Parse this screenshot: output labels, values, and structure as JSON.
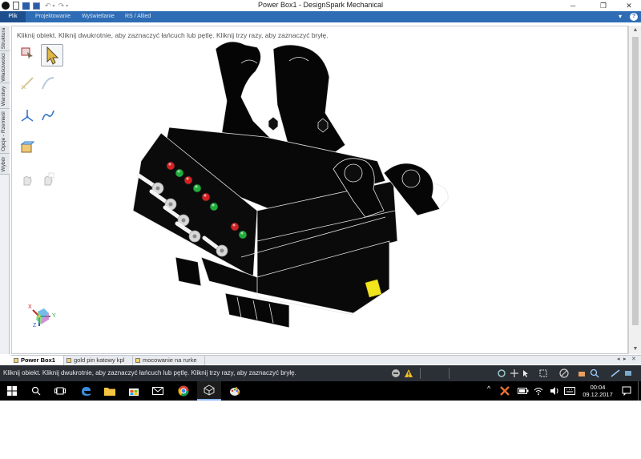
{
  "window": {
    "title": "Power Box1 - DesignSpark Mechanical",
    "minimize_glyph": "─",
    "maximize_glyph": "❐",
    "close_glyph": "✕"
  },
  "ribbon": {
    "tabs": [
      "Plik",
      "Projektowanie",
      "Wyświetlanie",
      "RS / Allied"
    ],
    "active_tab": "Plik"
  },
  "side_tabs": [
    "Struktura",
    "Właściwości",
    "Warstwy",
    "Opcje - Rzemieśl",
    "Wybór"
  ],
  "viewport": {
    "hint": "Kliknij obiekt. Kliknij dwukrotnie, aby zaznaczyć łańcuch lub pętlę. Kliknij trzy razy, aby zaznaczyć bryłę.",
    "axis_labels": {
      "x": "X",
      "y": "Y",
      "z": "Z"
    }
  },
  "tools": [
    {
      "name": "select-box-icon",
      "selected": false
    },
    {
      "name": "select-arrow-icon",
      "selected": true
    },
    {
      "name": "sketch-line-icon",
      "selected": false
    },
    {
      "name": "sketch-curve-icon",
      "selected": false
    },
    {
      "name": "axis-origin-icon",
      "selected": false
    },
    {
      "name": "spline-icon",
      "selected": false
    },
    {
      "name": "component-icon",
      "selected": false
    },
    {
      "name": "hand-tool-icon",
      "selected": false
    },
    {
      "name": "hand-select-icon",
      "selected": false
    }
  ],
  "doc_tabs": [
    {
      "label": "Power Box1",
      "active": true
    },
    {
      "label": "gold pin katowy kpl",
      "active": false
    },
    {
      "label": "mocowanie na rurke",
      "active": false
    }
  ],
  "status": {
    "message": "Kliknij obiekt. Kliknij dwukrotnie, aby zaznaczyć łańcuch lub pętlę. Kliknij trzy razy, aby zaznaczyć bryłę."
  },
  "taskbar": {
    "time": "00:04",
    "date": "09.12.2017"
  },
  "colors": {
    "ribbon": "#2e6db5",
    "ribbon_active": "#1d4f8f",
    "status_bar": "#2b2f36",
    "taskbar": "#000000",
    "led_red": "#d42020",
    "led_green": "#1fae3a",
    "connector_yellow": "#f2e41c"
  }
}
